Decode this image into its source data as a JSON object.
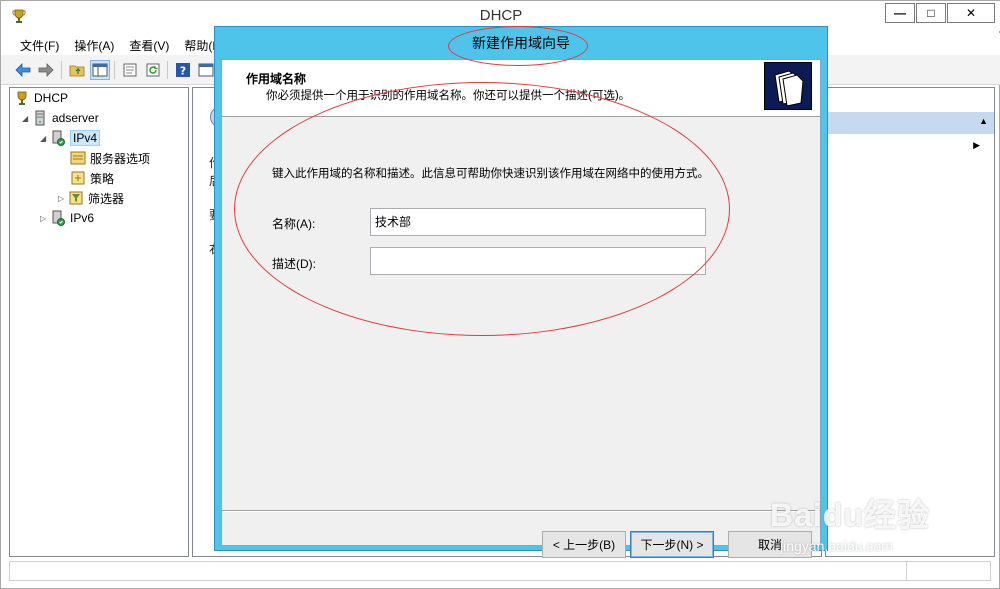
{
  "window": {
    "title": "DHCP",
    "minimize": "—",
    "maximize": "□",
    "close": "✕"
  },
  "menu": [
    "文件(F)",
    "操作(A)",
    "查看(V)",
    "帮助(H)"
  ],
  "toolbar": {
    "icons": [
      "back-arrow-icon",
      "forward-arrow-icon",
      "up-folder-icon",
      "show-hide-tree-icon",
      "properties-icon",
      "refresh-icon",
      "help-icon",
      "console-icon"
    ]
  },
  "tree": {
    "root": "DHCP",
    "server": "adserver",
    "ipv4": "IPv4",
    "server_options": "服务器选项",
    "policies": "策略",
    "filters": "筛选器",
    "ipv6": "IPv6"
  },
  "center_peek": [
    "作",
    "后",
    "要",
    "右"
  ],
  "wizard": {
    "title": "新建作用域向导",
    "header_title": "作用域名称",
    "header_subtitle": "你必须提供一个用于识别的作用域名称。你还可以提供一个描述(可选)。",
    "prompt": "键入此作用域的名称和描述。此信息可帮助你快速识别该作用域在网络中的使用方式。",
    "name_label": "名称(A):",
    "name_value": "技术部",
    "desc_label": "描述(D):",
    "desc_value": "",
    "back_button": "< 上一步(B)",
    "next_button": "下一步(N) >",
    "cancel_button": "取消"
  },
  "watermark": {
    "logo": "Baidu经验",
    "url": "jingyan.baidu.com"
  },
  "colors": {
    "wizard_frame": "#4ec4ea",
    "annotation": "#e23b3b",
    "selection": "#cce8ff"
  }
}
